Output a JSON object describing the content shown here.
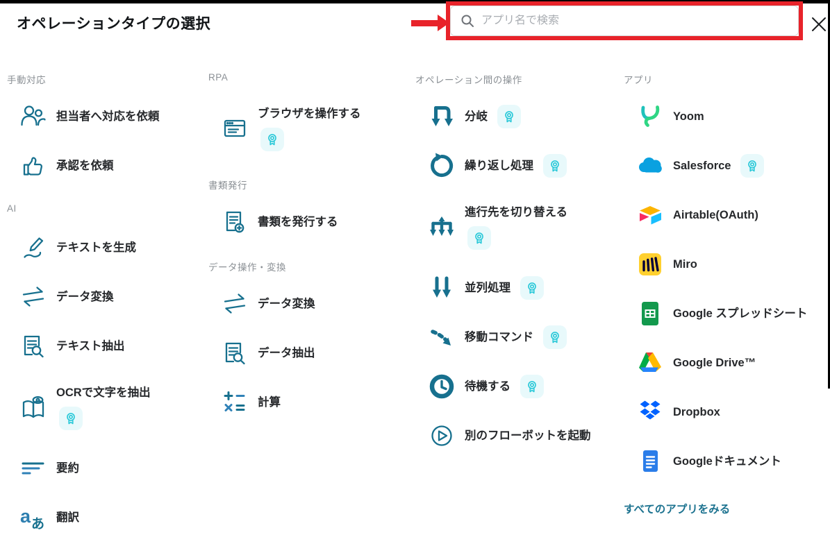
{
  "header": {
    "title": "オペレーションタイプの選択",
    "search_placeholder": "アプリ名で検索",
    "search_icon": "magnifier",
    "close_icon": "x-close",
    "annotation": {
      "shape": "red-box-and-arrow",
      "color": "#e8232a"
    }
  },
  "colors": {
    "icon_teal": "#17708e",
    "badge_cyan": "#29c8d8",
    "badge_bg": "#e8f9fb",
    "label": "#26282b",
    "section_title": "#8b9095",
    "link": "#1d7390"
  },
  "columns": [
    {
      "sections": [
        {
          "title": "手動対応",
          "items": [
            {
              "label": "担当者へ対応を依頼",
              "icon": "people"
            },
            {
              "label": "承認を依頼",
              "icon": "thumbs-up"
            }
          ]
        },
        {
          "title": "AI",
          "items": [
            {
              "label": "テキストを生成",
              "icon": "generate-text"
            },
            {
              "label": "データ変換",
              "icon": "swap-arrows"
            },
            {
              "label": "テキスト抽出",
              "icon": "document-search"
            },
            {
              "label": "OCRで文字を抽出",
              "icon": "book-eye",
              "badge": "below"
            },
            {
              "label": "要約",
              "icon": "summary-lines"
            },
            {
              "label": "翻訳",
              "icon": "translate"
            }
          ]
        }
      ]
    },
    {
      "sections": [
        {
          "title": "RPA",
          "items": [
            {
              "label": "ブラウザを操作する",
              "icon": "browser",
              "badge": "below"
            }
          ]
        },
        {
          "title": "書類発行",
          "items": [
            {
              "label": "書類を発行する",
              "icon": "document-add"
            }
          ]
        },
        {
          "title": "データ操作・変換",
          "items": [
            {
              "label": "データ変換",
              "icon": "swap-arrows"
            },
            {
              "label": "データ抽出",
              "icon": "document-search"
            },
            {
              "label": "計算",
              "icon": "calculator"
            }
          ]
        }
      ]
    },
    {
      "sections": [
        {
          "title": "オペレーション間の操作",
          "items": [
            {
              "label": "分岐",
              "icon": "branch",
              "badge": "inline"
            },
            {
              "label": "繰り返し処理",
              "icon": "repeat-loop",
              "badge": "inline"
            },
            {
              "label": "進行先を切り替える",
              "icon": "switch-path",
              "badge": "below"
            },
            {
              "label": "並列処理",
              "icon": "parallel-arrows",
              "badge": "inline"
            },
            {
              "label": "移動コマンド",
              "icon": "move-command",
              "badge": "inline"
            },
            {
              "label": "待機する",
              "icon": "wait-clock",
              "badge": "inline"
            },
            {
              "label": "別のフローボットを起動",
              "icon": "launch-flowbot"
            }
          ]
        }
      ]
    },
    {
      "sections": [
        {
          "title": "アプリ",
          "items": [
            {
              "label": "Yoom",
              "icon": "yoom-logo"
            },
            {
              "label": "Salesforce",
              "icon": "salesforce-logo",
              "badge": "inline"
            },
            {
              "label": "Airtable(OAuth)",
              "icon": "airtable-logo"
            },
            {
              "label": "Miro",
              "icon": "miro-logo"
            },
            {
              "label": "Google スプレッドシート",
              "icon": "google-sheets-logo"
            },
            {
              "label": "Google Drive™",
              "icon": "google-drive-logo"
            },
            {
              "label": "Dropbox",
              "icon": "dropbox-logo"
            },
            {
              "label": "Googleドキュメント",
              "icon": "google-docs-logo"
            }
          ]
        }
      ],
      "see_all": "すべてのアプリをみる"
    }
  ]
}
